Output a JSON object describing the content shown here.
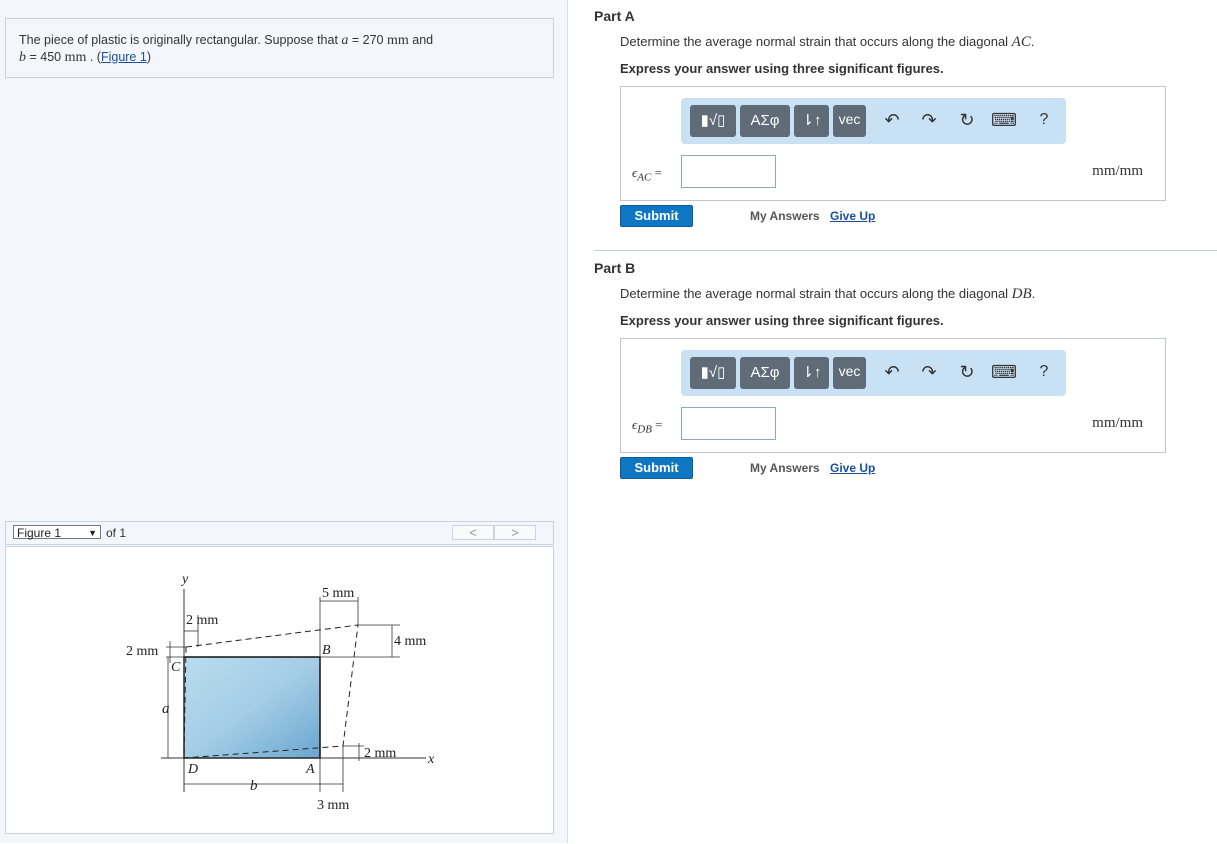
{
  "problem": {
    "text_pre": "The piece of plastic is originally rectangular. Suppose that ",
    "a_var": "a",
    "a_eq": " = 270 ",
    "unit1": "mm",
    "and": " and",
    "b_var": "b",
    "b_eq": " = 450 ",
    "unit2": "mm",
    "dot": " . (",
    "figure_link": "Figure 1",
    "close": ")"
  },
  "figure_nav": {
    "selected": "Figure 1",
    "of_label": "of 1",
    "prev": "<",
    "next": ">"
  },
  "figure": {
    "y_axis": "y",
    "x_axis": "x",
    "dim_top_left": "2 mm",
    "dim_top_right": "5 mm",
    "dim_left": "2 mm",
    "dim_right_top": "4 mm",
    "dim_right_bottom": "2 mm",
    "dim_bottom": "3 mm",
    "label_a": "a",
    "label_b": "b",
    "pt_A": "A",
    "pt_B": "B",
    "pt_C": "C",
    "pt_D": "D"
  },
  "toolbar": {
    "templates": "▮√▯",
    "greek": "ΑΣφ",
    "arrows": "⇂↑",
    "vec": "vec",
    "undo_icon": "undo-icon",
    "redo_icon": "redo-icon",
    "reset_icon": "reset-icon",
    "keyboard_icon": "keyboard-icon",
    "help": "?"
  },
  "partA": {
    "title": "Part A",
    "question_pre": "Determine the average normal strain that occurs along the diagonal ",
    "diag": "AC",
    "question_post": ".",
    "instruction": "Express your answer using three significant figures.",
    "eps": "ϵ",
    "sub": "AC",
    "eq": " =",
    "units": "mm/mm",
    "submit": "Submit",
    "my_answers": "My Answers",
    "give_up": "Give Up"
  },
  "partB": {
    "title": "Part B",
    "question_pre": "Determine the average normal strain that occurs along the diagonal ",
    "diag": "DB",
    "question_post": ".",
    "instruction": "Express your answer using three significant figures.",
    "eps": "ϵ",
    "sub": "DB",
    "eq": " =",
    "units": "mm/mm",
    "submit": "Submit",
    "my_answers": "My Answers",
    "give_up": "Give Up"
  }
}
